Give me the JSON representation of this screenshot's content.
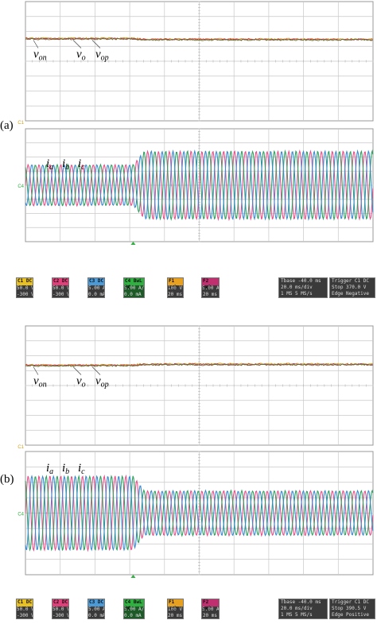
{
  "panels": [
    {
      "id": "a",
      "tag": "(a)",
      "voltage_labels": [
        "v_on",
        "v_o",
        "v_op"
      ],
      "current_labels": [
        "i_a",
        "i_b",
        "i_c"
      ],
      "transition_x_frac": 0.31,
      "voltage": {
        "before": 0.0,
        "after": -0.05
      },
      "current": {
        "amp_before": 0.6,
        "amp_after": 1.0,
        "cycles": 32
      },
      "channels": [
        {
          "name": "C1",
          "state": "DC",
          "v1": "50.0 V",
          "v2": "-300 V",
          "color": "#e8c020"
        },
        {
          "name": "C2",
          "state": "DC",
          "v1": "50.0 V",
          "v2": "-300 V",
          "color": "#e0407a"
        },
        {
          "name": "C3",
          "state": "DC",
          "v1": "5.00 A",
          "v2": "0.0 mA",
          "color": "#4a9ad8"
        },
        {
          "name": "C4",
          "state": "BwL DC",
          "v1": "5.00 A/div",
          "v2": "0.0 mA ofst",
          "color": "#30b040",
          "active": true
        },
        {
          "name": "F1",
          "state": "web",
          "v1": "100 V",
          "v2": "20 ms",
          "color": "#e8a020"
        },
        {
          "name": "F2",
          "state": "web",
          "v1": "5.00 A",
          "v2": "20 ms",
          "color": "#c03070"
        }
      ],
      "timebase": {
        "title": "Tbase",
        "value": "-40.0 ms",
        "l1": "20.0 ms/div",
        "l2": "1 MS",
        "l3": "5 MS/s"
      },
      "trigger": {
        "title": "Trigger",
        "ch": "C1 DC",
        "l1": "Stop",
        "v1": "370.0 V",
        "l2": "Edge",
        "v2": "Negative"
      }
    },
    {
      "id": "b",
      "tag": "(b)",
      "voltage_labels": [
        "v_on",
        "v_o",
        "v_op"
      ],
      "current_labels": [
        "i_a",
        "i_b",
        "i_c"
      ],
      "transition_x_frac": 0.31,
      "voltage": {
        "before": 0.0,
        "after": 0.05
      },
      "current": {
        "amp_before": 1.0,
        "amp_after": 0.6,
        "cycles": 32
      },
      "channels": [
        {
          "name": "C1",
          "state": "DC",
          "v1": "50.0 V",
          "v2": "-300 V",
          "color": "#e8c020"
        },
        {
          "name": "C2",
          "state": "DC",
          "v1": "50.0 V",
          "v2": "-300 V",
          "color": "#e0407a"
        },
        {
          "name": "C3",
          "state": "DC",
          "v1": "5.00 A",
          "v2": "0.0 mA",
          "color": "#4a9ad8"
        },
        {
          "name": "C4",
          "state": "BwL DC",
          "v1": "5.00 A/div",
          "v2": "0.0 mA ofst",
          "color": "#30b040",
          "active": true
        },
        {
          "name": "F1",
          "state": "web",
          "v1": "100 V",
          "v2": "20 ms",
          "color": "#e8a020"
        },
        {
          "name": "F2",
          "state": "web",
          "v1": "5.00 A",
          "v2": "20 ms",
          "color": "#c03070"
        }
      ],
      "timebase": {
        "title": "Tbase",
        "value": "-40.0 ms",
        "l1": "20.0 ms/div",
        "l2": "1 MS",
        "l3": "5 MS/s"
      },
      "trigger": {
        "title": "Trigger",
        "ch": "C1 DC",
        "l1": "Stop",
        "v1": "390.5 V",
        "l2": "Edge",
        "v2": "Positive"
      }
    }
  ],
  "colors": {
    "grid": "#c8c8c8",
    "grid_dot": "#b4b4b4",
    "frame": "#999999",
    "phase_a": "#e8508a",
    "phase_b": "#2fa060",
    "phase_c": "#3a8ad0",
    "v_n": "#d0a020",
    "v_o": "#c03050",
    "v_p": "#607030"
  },
  "chart_data": [
    {
      "type": "line",
      "title": "",
      "series": [
        {
          "name": "v_on",
          "values": [
            0,
            0,
            0,
            -0.05,
            -0.05,
            -0.05
          ]
        },
        {
          "name": "v_o",
          "values": [
            0,
            0,
            0,
            -0.05,
            -0.05,
            -0.05
          ]
        },
        {
          "name": "v_op",
          "values": [
            0,
            0,
            0,
            -0.05,
            -0.05,
            -0.05
          ]
        },
        {
          "name": "i_a",
          "values": [
            0.6,
            0.6,
            0.6,
            1.0,
            1.0,
            1.0
          ]
        },
        {
          "name": "i_b",
          "values": [
            0.6,
            0.6,
            0.6,
            1.0,
            1.0,
            1.0
          ]
        },
        {
          "name": "i_c",
          "values": [
            0.6,
            0.6,
            0.6,
            1.0,
            1.0,
            1.0
          ]
        }
      ],
      "xlabel": "",
      "ylabel": "",
      "grid": true
    },
    {
      "type": "line",
      "title": "",
      "series": [
        {
          "name": "v_on",
          "values": [
            0,
            0,
            0,
            0.05,
            0.05,
            0.05
          ]
        },
        {
          "name": "v_o",
          "values": [
            0,
            0,
            0,
            0.05,
            0.05,
            0.05
          ]
        },
        {
          "name": "v_op",
          "values": [
            0,
            0,
            0,
            0.05,
            0.05,
            0.05
          ]
        },
        {
          "name": "i_a",
          "values": [
            1.0,
            1.0,
            1.0,
            0.6,
            0.6,
            0.6
          ]
        },
        {
          "name": "i_b",
          "values": [
            1.0,
            1.0,
            1.0,
            0.6,
            0.6,
            0.6
          ]
        },
        {
          "name": "i_c",
          "values": [
            1.0,
            1.0,
            1.0,
            0.6,
            0.6,
            0.6
          ]
        }
      ],
      "xlabel": "",
      "ylabel": "",
      "grid": true
    }
  ]
}
